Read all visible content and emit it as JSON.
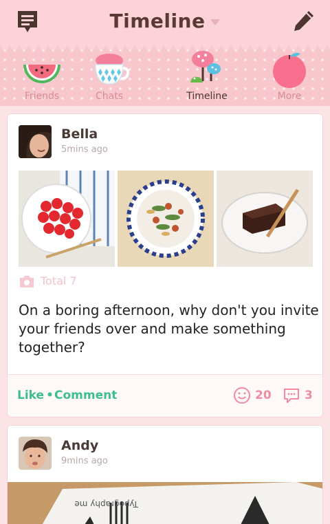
{
  "header": {
    "title": "Timeline"
  },
  "tabs": [
    {
      "label": "Friends",
      "icon": "watermelon-icon"
    },
    {
      "label": "Chats",
      "icon": "teacup-icon"
    },
    {
      "label": "Timeline",
      "icon": "mushroom-icon",
      "active": true
    },
    {
      "label": "More",
      "icon": "apple-icon"
    }
  ],
  "posts": [
    {
      "user": "Bella",
      "time": "5mins ago",
      "total": "Total 7",
      "text": "On a boring afternoon, why don't you invite your friends over and make something together?",
      "like": "Like",
      "separator": "•",
      "comment": "Comment",
      "smiles": "20",
      "comments": "3"
    },
    {
      "user": "Andy",
      "time": "9mins ago",
      "photo_text": "Typography me"
    }
  ],
  "colors": {
    "accent_green": "#3cbf8a",
    "accent_pink": "#ef8aa0",
    "bar_pink": "#fbd3d8"
  }
}
